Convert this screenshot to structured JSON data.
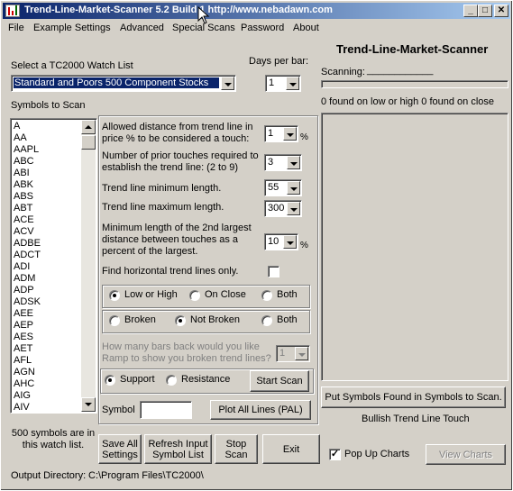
{
  "title": {
    "text": "Trend-Line-Market-Scanner  5.2 Build 1   http://www.nebadawn.com",
    "min": "_",
    "max": "□",
    "close": "✕"
  },
  "menu": [
    "File",
    "Example Settings",
    "Advanced",
    "Special Scans",
    "Password",
    "About"
  ],
  "watchlist": {
    "label": "Select a TC2000 Watch List",
    "value": "Standard and Poors 500 Component Stocks"
  },
  "days_per_bar": {
    "label": "Days per bar:",
    "value": "1"
  },
  "symbols": {
    "label": "Symbols to Scan",
    "items": [
      "A",
      "AA",
      "AAPL",
      "ABC",
      "ABI",
      "ABK",
      "ABS",
      "ABT",
      "ACE",
      "ACV",
      "ADBE",
      "ADCT",
      "ADI",
      "ADM",
      "ADP",
      "ADSK",
      "AEE",
      "AEP",
      "AES",
      "AET",
      "AFL",
      "AGN",
      "AHC",
      "AIG",
      "AIV"
    ],
    "count_text": "500 symbols are in this watch list."
  },
  "settings": {
    "distance": {
      "label": "Allowed distance from trend line in price % to be considered a touch:",
      "value": "1",
      "unit": "%"
    },
    "touches": {
      "label": "Number of prior touches required to establish the trend line: (2 to 9)",
      "value": "3"
    },
    "min_len": {
      "label": "Trend line minimum length.",
      "value": "55"
    },
    "max_len": {
      "label": "Trend line maximum length.",
      "value": "300"
    },
    "second_len": {
      "label": "Minimum length of the 2nd largest distance between touches as a percent of the largest.",
      "value": "10",
      "unit": "%"
    },
    "horizontal": {
      "label": "Find horizontal trend lines only.",
      "checked": false
    },
    "touch_type": {
      "options": [
        "Low or High",
        "On Close",
        "Both"
      ],
      "selected": 0
    },
    "broken": {
      "options": [
        "Broken",
        "Not Broken",
        "Both"
      ],
      "selected": 1
    },
    "bars_back": {
      "label": "How many bars back would you like Ramp to show you broken trend lines?",
      "value": "1"
    },
    "sr": {
      "options": [
        "Support",
        "Resistance"
      ],
      "selected": 0
    },
    "start_scan": "Start Scan",
    "symbol_label": "Symbol",
    "symbol_value": "",
    "plot_all": "Plot All Lines (PAL)"
  },
  "buttons": {
    "save_all": "Save All Settings",
    "refresh": "Refresh  Input Symbol List",
    "stop": "Stop Scan",
    "exit": "Exit"
  },
  "output_dir": {
    "label": "Output Directory:",
    "value": "C:\\Program Files\\TC2000\\"
  },
  "right": {
    "heading": "Trend-Line-Market-Scanner",
    "scanning_label": "Scanning:",
    "scanning_value": "____________",
    "found_text": "0 found on low or high 0 found on close",
    "put_symbols": "Put Symbols Found in Symbols to Scan.",
    "pattern": "Bullish Trend Line Touch",
    "popup_label": "Pop Up Charts",
    "popup_checked": true,
    "view_charts": "View Charts"
  }
}
